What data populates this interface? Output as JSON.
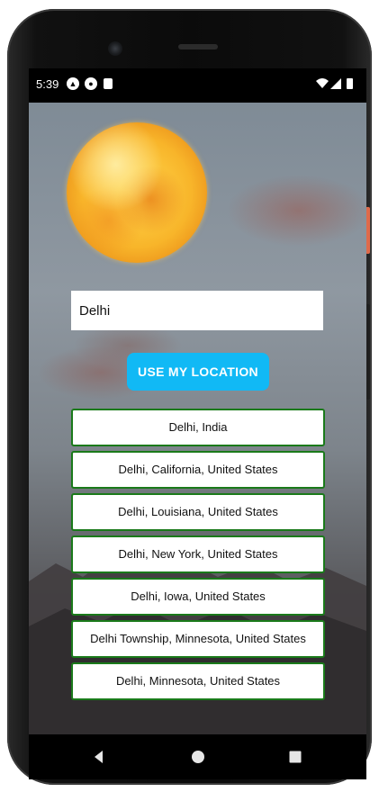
{
  "status_bar": {
    "time": "5:39"
  },
  "search": {
    "value": "Delhi"
  },
  "location_button": {
    "label": "USE MY LOCATION"
  },
  "results": [
    "Delhi, India",
    "Delhi, California, United States",
    "Delhi, Louisiana, United States",
    "Delhi, New York, United States",
    "Delhi, Iowa, United States",
    "Delhi Township, Minnesota, United States",
    "Delhi, Minnesota, United States"
  ],
  "colors": {
    "accent": "#11b9f5",
    "result_border": "#1a7a1a"
  }
}
